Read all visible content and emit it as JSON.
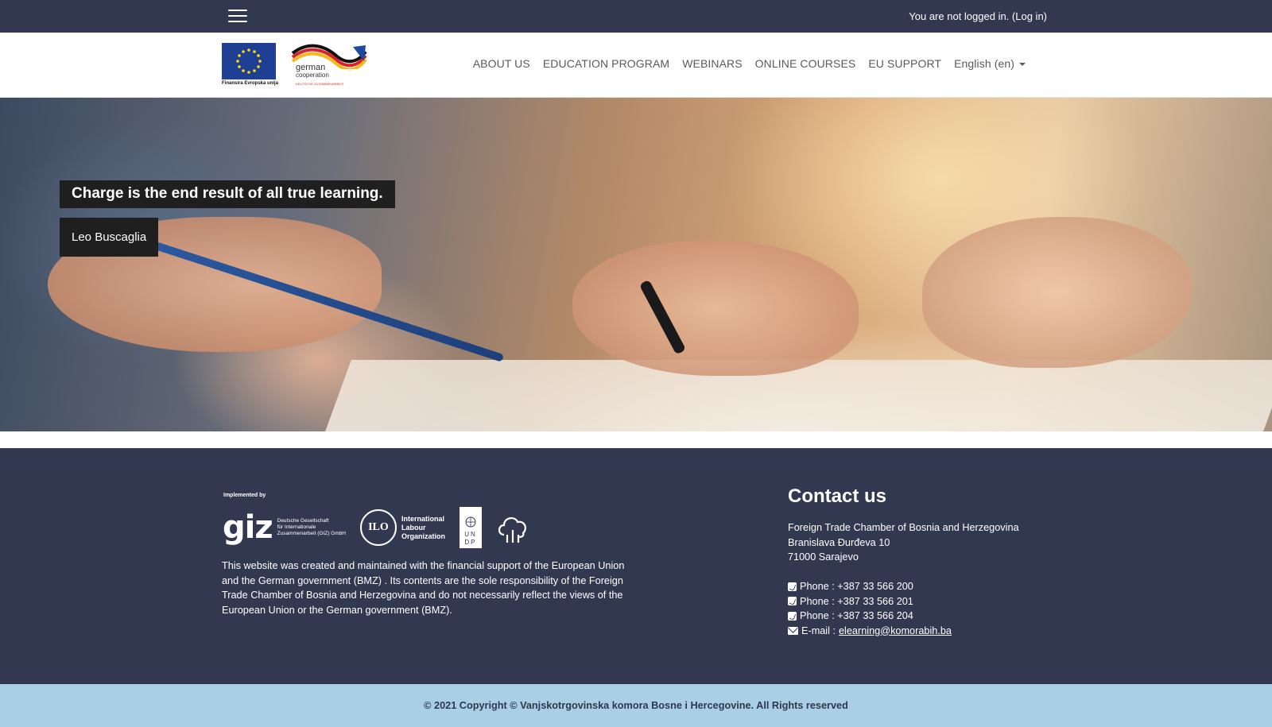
{
  "topbar": {
    "login_text": "You are not logged in.",
    "login_link": "(Log in)"
  },
  "header": {
    "eu_caption": "Finansira Evropska unija",
    "gc_line1": "german",
    "gc_line2": "cooperation",
    "gc_line3": "DEUTSCHE ZUSAMMENARBEIT",
    "nav": [
      {
        "label": "ABOUT US"
      },
      {
        "label": "EDUCATION PROGRAM"
      },
      {
        "label": "WEBINARS"
      },
      {
        "label": "ONLINE COURSES"
      },
      {
        "label": "EU SUPPORT"
      },
      {
        "label": "English (en)"
      }
    ]
  },
  "hero": {
    "quote": "Charge is the end result of all true learning.",
    "author": "Leo Buscaglia"
  },
  "footer": {
    "implemented_by": "Implemented by",
    "giz_mark": "giz",
    "giz_text_1": "Deutsche Gesellschaft",
    "giz_text_2": "für Internationale",
    "giz_text_3": "Zusammenarbeit (GIZ) GmbH",
    "ilo_mark": "ILO",
    "ilo_text_1": "International",
    "ilo_text_2": "Labour",
    "ilo_text_3": "Organization",
    "undp_1": "UN",
    "undp_2": "DP",
    "disclaimer": "This website was created and maintained with the financial support of the European Union and the German government (BMZ) . Its contents are the sole responsibility of the Foreign Trade Chamber of Bosnia and Herzegovina and do not necessarily reflect the views of the European Union or the German government (BMZ).",
    "contact": {
      "title": "Contact us",
      "org": "Foreign Trade Chamber of Bosnia and Herzegovina",
      "street": "Branislava Đurđeva 10",
      "city": "71000 Sarajevo",
      "phones": [
        "Phone : +387 33 566 200",
        "Phone : +387 33 566 201",
        "Phone : +387 33 566 204"
      ],
      "email_label": "E-mail :",
      "email": "elearning@komorabih.ba"
    }
  },
  "copyright": "© 2021 Copyright © Vanjskotrgovinska komora Bosne i Hercegovine. All Rights reserved",
  "icons": {
    "menu": "hamburger-icon",
    "phone": "phone-icon",
    "email": "envelope-icon",
    "caret": "caret-down-icon"
  },
  "colors": {
    "navy": "#333851",
    "copyright_bg": "#a9cfe4",
    "eu_blue": "#1f3f95",
    "eu_star": "#ffdd00"
  }
}
